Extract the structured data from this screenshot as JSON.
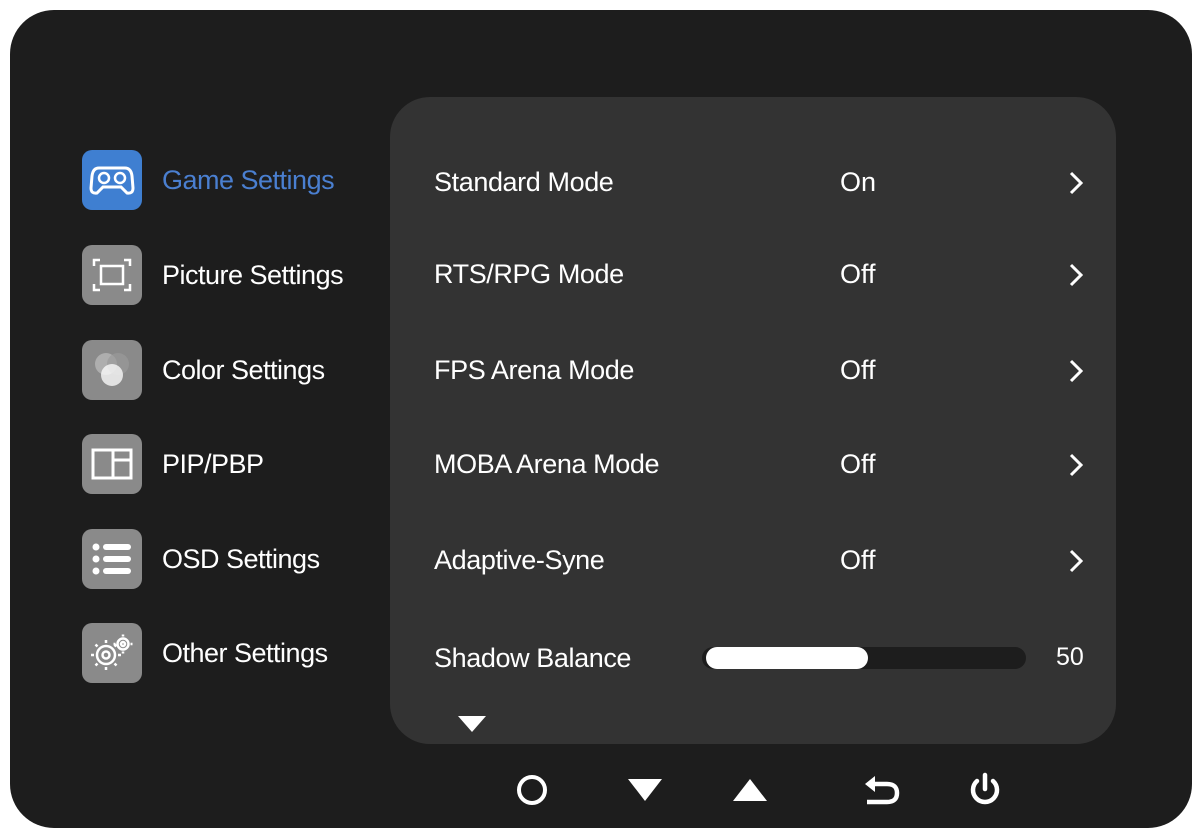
{
  "sidebar": {
    "items": [
      {
        "label": "Game Settings",
        "icon": "gamepad-icon",
        "active": true
      },
      {
        "label": "Picture Settings",
        "icon": "picture-frame-icon",
        "active": false
      },
      {
        "label": "Color Settings",
        "icon": "color-circles-icon",
        "active": false
      },
      {
        "label": "PIP/PBP",
        "icon": "pip-window-icon",
        "active": false
      },
      {
        "label": "OSD Settings",
        "icon": "list-icon",
        "active": false
      },
      {
        "label": "Other Settings",
        "icon": "gears-icon",
        "active": false
      }
    ]
  },
  "panel": {
    "rows": [
      {
        "label": "Standard Mode",
        "value": "On"
      },
      {
        "label": "RTS/RPG Mode",
        "value": "Off"
      },
      {
        "label": "FPS Arena Mode",
        "value": "Off"
      },
      {
        "label": "MOBA Arena Mode",
        "value": "Off"
      },
      {
        "label": "Adaptive-Syne",
        "value": "Off"
      }
    ],
    "slider": {
      "label": "Shadow Balance",
      "value": "50",
      "fill_fraction": 0.5
    }
  },
  "buttons": [
    {
      "icon": "circle-icon"
    },
    {
      "icon": "triangle-down-icon"
    },
    {
      "icon": "triangle-up-icon"
    },
    {
      "icon": "return-icon"
    },
    {
      "icon": "power-icon"
    }
  ],
  "colors": {
    "accent": "#3f7fd1",
    "bezel": "#1d1d1d",
    "panel": "#333333",
    "icon_gray": "#8a8a8a"
  }
}
